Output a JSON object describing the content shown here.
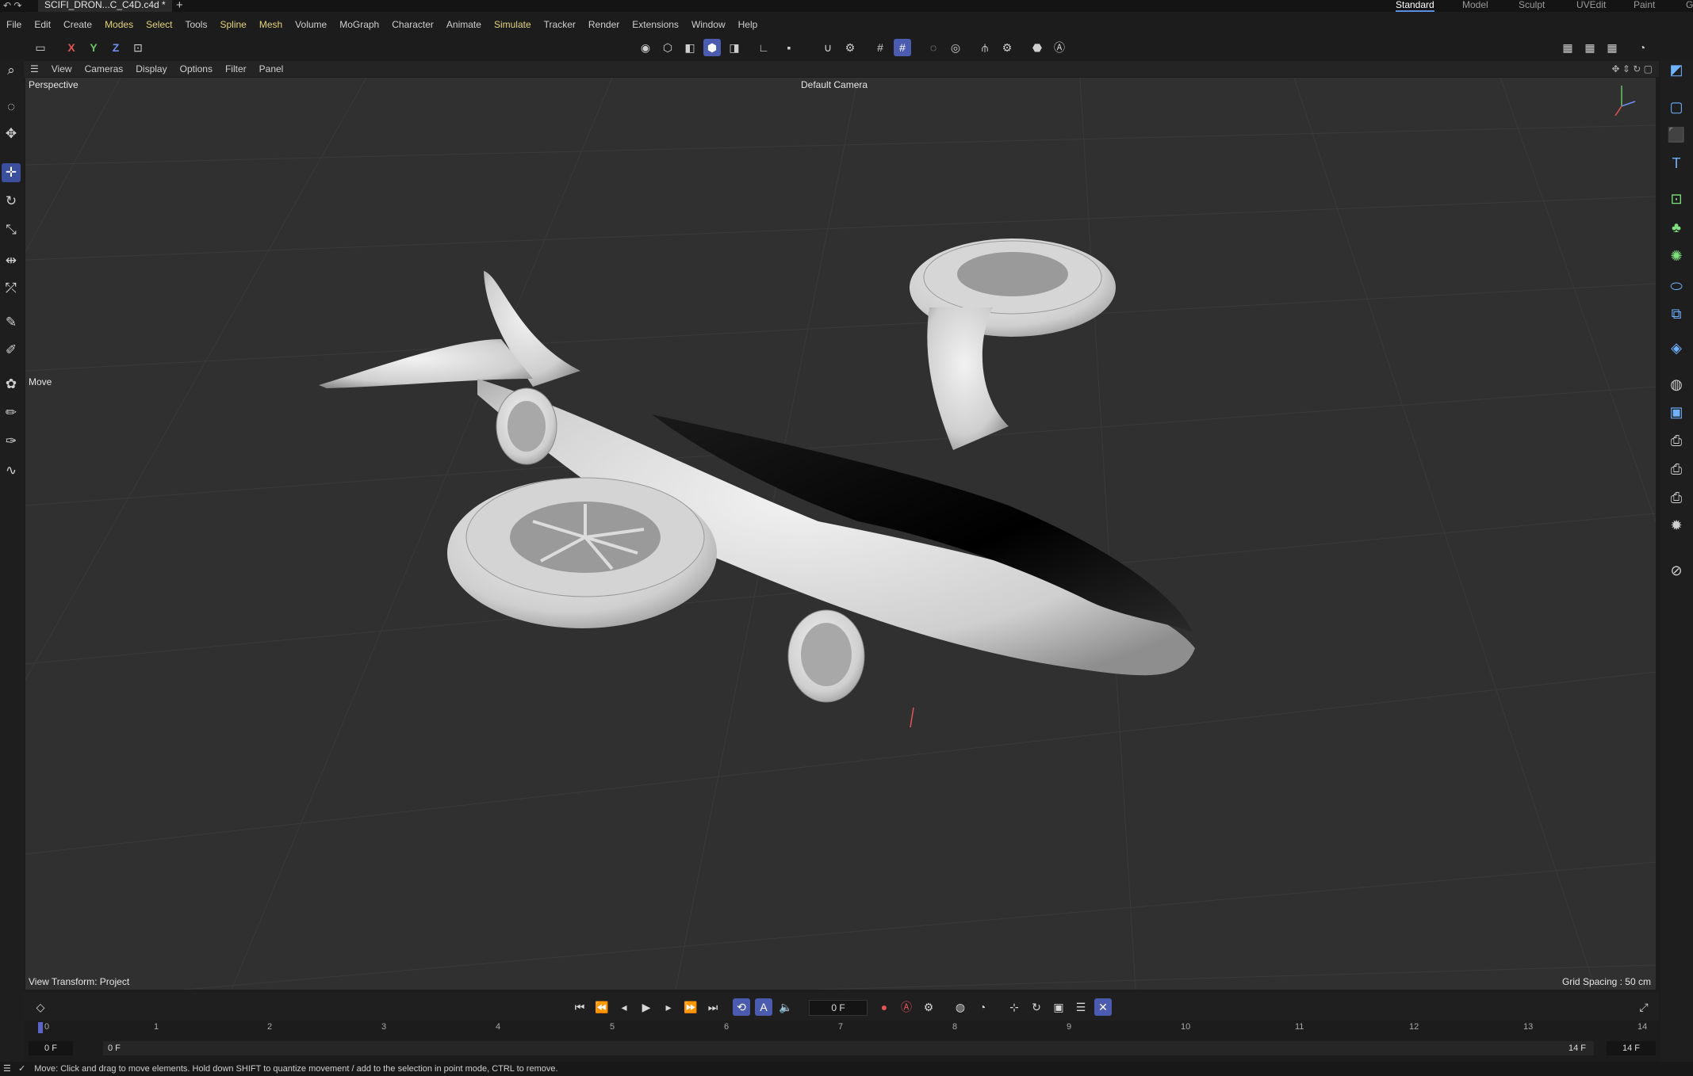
{
  "window": {
    "document_tab": "SCIFI_DRON...C_C4D.c4d *",
    "add_tab": "+",
    "layouts": [
      "Standard",
      "Model",
      "Sculpt",
      "UVEdit",
      "Paint"
    ],
    "active_layout": "Standard",
    "truncated_right": "G"
  },
  "menu": [
    "File",
    "Edit",
    "Create",
    "Modes",
    "Select",
    "Tools",
    "Spline",
    "Mesh",
    "Volume",
    "MoGraph",
    "Character",
    "Animate",
    "Simulate",
    "Tracker",
    "Render",
    "Extensions",
    "Window",
    "Help"
  ],
  "toolbar": {
    "axis_x": "X",
    "axis_y": "Y",
    "axis_z": "Z"
  },
  "viewport_menu": [
    "View",
    "Cameras",
    "Display",
    "Options",
    "Filter",
    "Panel"
  ],
  "viewport": {
    "label": "Perspective",
    "camera": "Default Camera",
    "active_tool": "Move",
    "view_transform": "View Transform: Project",
    "grid_spacing": "Grid Spacing : 50 cm"
  },
  "transport": {
    "current_frame": "0 F"
  },
  "timeline": {
    "ticks": [
      "0",
      "1",
      "2",
      "3",
      "4",
      "5",
      "6",
      "7",
      "8",
      "9",
      "10",
      "11",
      "12",
      "13",
      "14"
    ],
    "start": "0 F",
    "range_start": "0 F",
    "range_end": "14 F",
    "end": "14 F"
  },
  "status": "Move: Click and drag to move elements. Hold down SHIFT to quantize movement / add to the selection in point mode, CTRL to remove.",
  "colors": {
    "accent": "#4a5bb0",
    "viewport_bg": "#303030",
    "x_axis": "#e05555",
    "y_axis": "#6ac26a",
    "z_axis": "#6f8ef0"
  }
}
